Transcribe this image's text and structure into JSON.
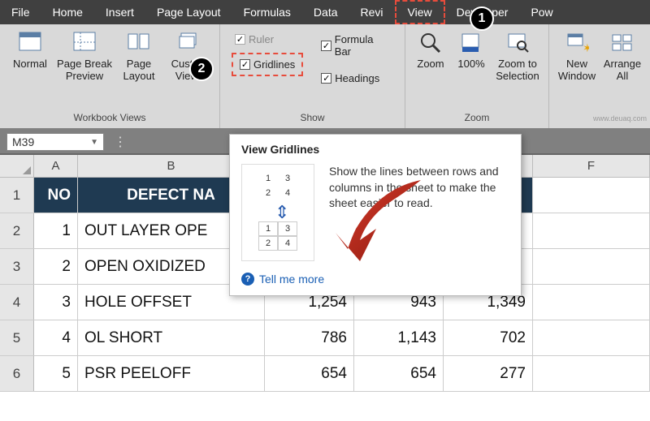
{
  "tabs": {
    "file": "File",
    "home": "Home",
    "insert": "Insert",
    "page_layout": "Page Layout",
    "formulas": "Formulas",
    "data": "Data",
    "review": "Revi",
    "view": "View",
    "developer": "Developer",
    "power": "Pow"
  },
  "ribbon": {
    "workbook_views": {
      "label": "Workbook Views",
      "normal": "Normal",
      "page_break": "Page Break\nPreview",
      "page_layout": "Page\nLayout",
      "custom": "Custom\nViews"
    },
    "show": {
      "label": "Show",
      "ruler": "Ruler",
      "gridlines": "Gridlines",
      "formula_bar": "Formula Bar",
      "headings": "Headings"
    },
    "zoom": {
      "label": "Zoom",
      "zoom": "Zoom",
      "hundred": "100%",
      "selection": "Zoom to\nSelection"
    },
    "window": {
      "new_window": "New\nWindow",
      "arrange": "Arrange\nAll"
    }
  },
  "namebox": "M39",
  "columns": {
    "A": "A",
    "B": "B",
    "F": "F"
  },
  "header_row": {
    "no": "NO",
    "defect": "DEFECT NA"
  },
  "rows": [
    {
      "rh": "1"
    },
    {
      "rh": "2",
      "no": "1",
      "defect": "OUT LAYER OPE"
    },
    {
      "rh": "3",
      "no": "2",
      "defect": "OPEN OXIDIZED"
    },
    {
      "rh": "4",
      "no": "3",
      "defect": "HOLE OFFSET",
      "c3": "1,254",
      "c4": "943",
      "c5": "1,349"
    },
    {
      "rh": "5",
      "no": "4",
      "defect": "OL SHORT",
      "c3": "786",
      "c4": "1,143",
      "c5": "702"
    },
    {
      "rh": "6",
      "no": "5",
      "defect": "PSR PEELOFF",
      "c3": "654",
      "c4": "654",
      "c5": "277"
    }
  ],
  "tooltip": {
    "title": "View Gridlines",
    "text": "Show the lines between rows and columns in the sheet to make the sheet easier to read.",
    "more": "Tell me more",
    "ill": {
      "a": "1",
      "b": "3",
      "c": "2",
      "d": "4"
    }
  },
  "badges": {
    "one": "1",
    "two": "2"
  },
  "watermark": "www.deuaq.com"
}
